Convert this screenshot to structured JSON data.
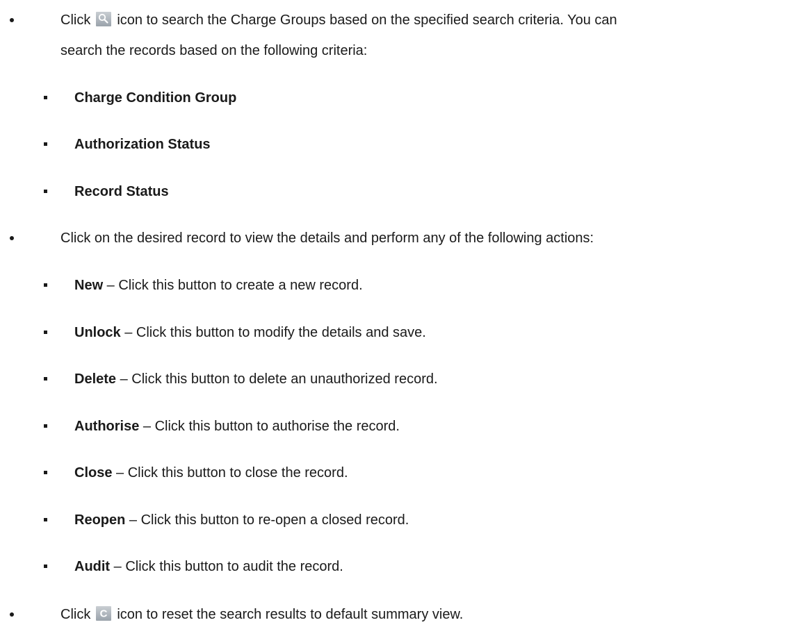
{
  "search_item": {
    "prefix": "Click",
    "icon": "search-icon",
    "line1": "icon to search the Charge Groups based on the specified search criteria. You can",
    "line2": "search the records based on the following criteria:"
  },
  "criteria": [
    "Charge Condition Group",
    "Authorization Status",
    "Record Status"
  ],
  "record_item": {
    "text": "Click on the desired record to view the details and perform any of the following actions:"
  },
  "actions": [
    {
      "name": "New",
      "desc": " – Click this button to create a new record."
    },
    {
      "name": "Unlock",
      "desc": " – Click this button to modify the details and save."
    },
    {
      "name": "Delete",
      "desc": " – Click this button to delete an unauthorized record."
    },
    {
      "name": "Authorise",
      "desc": " – Click this button to authorise the record."
    },
    {
      "name": "Close",
      "desc": " – Click this button to close the record."
    },
    {
      "name": "Reopen",
      "desc": " – Click this button to re-open a closed record."
    },
    {
      "name": "Audit",
      "desc": " – Click this button to audit the record."
    }
  ],
  "reset_item": {
    "prefix": "Click",
    "icon": "reset-icon",
    "text": "icon to reset the search results to default summary view."
  }
}
